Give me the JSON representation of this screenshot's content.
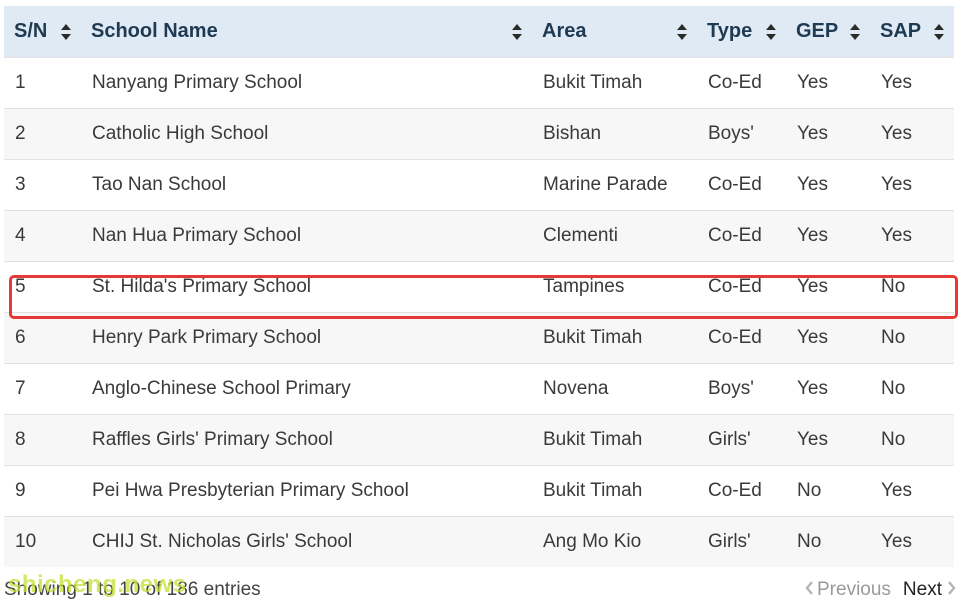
{
  "table": {
    "columns": [
      {
        "label": "S/N",
        "key": "sn"
      },
      {
        "label": "School Name",
        "key": "name"
      },
      {
        "label": "Area",
        "key": "area"
      },
      {
        "label": "Type",
        "key": "type"
      },
      {
        "label": "GEP",
        "key": "gep"
      },
      {
        "label": "SAP",
        "key": "sap"
      }
    ],
    "rows": [
      {
        "sn": "1",
        "name": "Nanyang Primary School",
        "area": "Bukit Timah",
        "type": "Co-Ed",
        "gep": "Yes",
        "sap": "Yes"
      },
      {
        "sn": "2",
        "name": "Catholic High School",
        "area": "Bishan",
        "type": "Boys'",
        "gep": "Yes",
        "sap": "Yes"
      },
      {
        "sn": "3",
        "name": "Tao Nan School",
        "area": "Marine Parade",
        "type": "Co-Ed",
        "gep": "Yes",
        "sap": "Yes"
      },
      {
        "sn": "4",
        "name": "Nan Hua Primary School",
        "area": "Clementi",
        "type": "Co-Ed",
        "gep": "Yes",
        "sap": "Yes"
      },
      {
        "sn": "5",
        "name": "St. Hilda's Primary School",
        "area": "Tampines",
        "type": "Co-Ed",
        "gep": "Yes",
        "sap": "No"
      },
      {
        "sn": "6",
        "name": "Henry Park Primary School",
        "area": "Bukit Timah",
        "type": "Co-Ed",
        "gep": "Yes",
        "sap": "No"
      },
      {
        "sn": "7",
        "name": "Anglo-Chinese School Primary",
        "area": "Novena",
        "type": "Boys'",
        "gep": "Yes",
        "sap": "No"
      },
      {
        "sn": "8",
        "name": "Raffles Girls' Primary School",
        "area": "Bukit Timah",
        "type": "Girls'",
        "gep": "Yes",
        "sap": "No"
      },
      {
        "sn": "9",
        "name": "Pei Hwa Presbyterian Primary School",
        "area": "Bukit Timah",
        "type": "Co-Ed",
        "gep": "No",
        "sap": "Yes"
      },
      {
        "sn": "10",
        "name": "CHIJ St. Nicholas Girls' School",
        "area": "Ang Mo Kio",
        "type": "Girls'",
        "gep": "No",
        "sap": "Yes"
      }
    ],
    "highlighted_row_sn": "5"
  },
  "footer": {
    "info": "Showing 1 to 10 of 186 entries",
    "previous_label": "Previous",
    "next_label": "Next"
  },
  "watermark": "shicheng.news",
  "colors": {
    "header_bg": "#dfeaf5",
    "highlight": "#e53935",
    "watermark": "#c6e036"
  },
  "icons": {
    "sort": "sort-arrows-icon",
    "previous": "chevron-left-icon",
    "next": "chevron-right-icon"
  }
}
